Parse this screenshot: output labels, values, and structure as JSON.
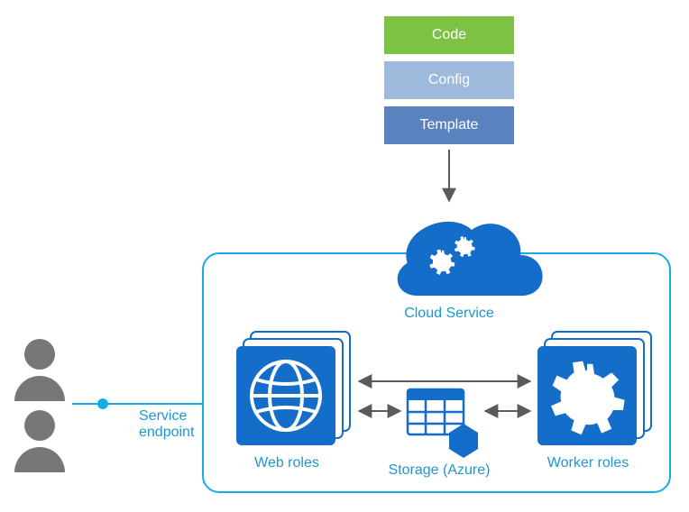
{
  "package": {
    "code": {
      "label": "Code",
      "color": "#7dc243"
    },
    "config": {
      "label": "Config",
      "color": "#9db9dc"
    },
    "template": {
      "label": "Template",
      "color": "#5a82bf"
    }
  },
  "cloudService": {
    "label": "Cloud Service"
  },
  "webRoles": {
    "label": "Web roles"
  },
  "workerRoles": {
    "label": "Worker roles"
  },
  "storage": {
    "label": "Storage (Azure)"
  },
  "endpoint": {
    "label": "Service\nendpoint"
  },
  "colors": {
    "azureBlue": "#136dc9",
    "outline": "#18ace0",
    "textBlue": "#1f96d1"
  }
}
